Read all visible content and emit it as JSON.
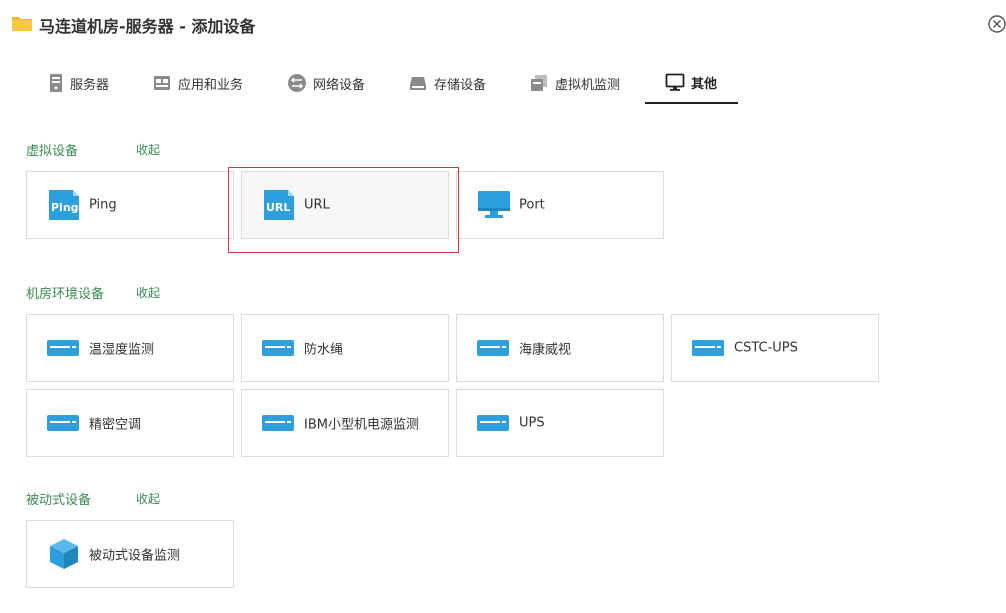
{
  "window": {
    "title": "马连道机房-服务器 - 添加设备"
  },
  "tabs": [
    {
      "label": "服务器",
      "icon": "server-icon",
      "active": false
    },
    {
      "label": "应用和业务",
      "icon": "application-icon",
      "active": false
    },
    {
      "label": "网络设备",
      "icon": "network-device-icon",
      "active": false
    },
    {
      "label": "存储设备",
      "icon": "storage-device-icon",
      "active": false
    },
    {
      "label": "虚拟机监测",
      "icon": "virtual-machine-icon",
      "active": false
    },
    {
      "label": "其他",
      "icon": "monitor-icon",
      "active": true
    }
  ],
  "sections": {
    "virtual": {
      "title": "虚拟设备",
      "collapse": "收起",
      "items": [
        {
          "label": "Ping",
          "icon": "ping-icon"
        },
        {
          "label": "URL",
          "icon": "url-icon",
          "selected": true
        },
        {
          "label": "Port",
          "icon": "port-monitor-icon"
        }
      ]
    },
    "room": {
      "title": "机房环境设备",
      "collapse": "收起",
      "items": [
        {
          "label": "温湿度监测",
          "icon": "device-icon"
        },
        {
          "label": "防水绳",
          "icon": "device-icon"
        },
        {
          "label": "海康威视",
          "icon": "device-icon"
        },
        {
          "label": "CSTC-UPS",
          "icon": "device-icon"
        },
        {
          "label": "精密空调",
          "icon": "device-icon"
        },
        {
          "label": "IBM小型机电源监测",
          "icon": "device-icon"
        },
        {
          "label": "UPS",
          "icon": "device-icon"
        }
      ]
    },
    "passive": {
      "title": "被动式设备",
      "collapse": "收起",
      "items": [
        {
          "label": "被动式设备监测",
          "icon": "cube-icon"
        }
      ]
    }
  },
  "colors": {
    "accent_green": "#3b8a55",
    "icon_blue": "#2d9fdc",
    "highlight_red": "#d9363e",
    "folder_yellow": "#f5b829"
  }
}
